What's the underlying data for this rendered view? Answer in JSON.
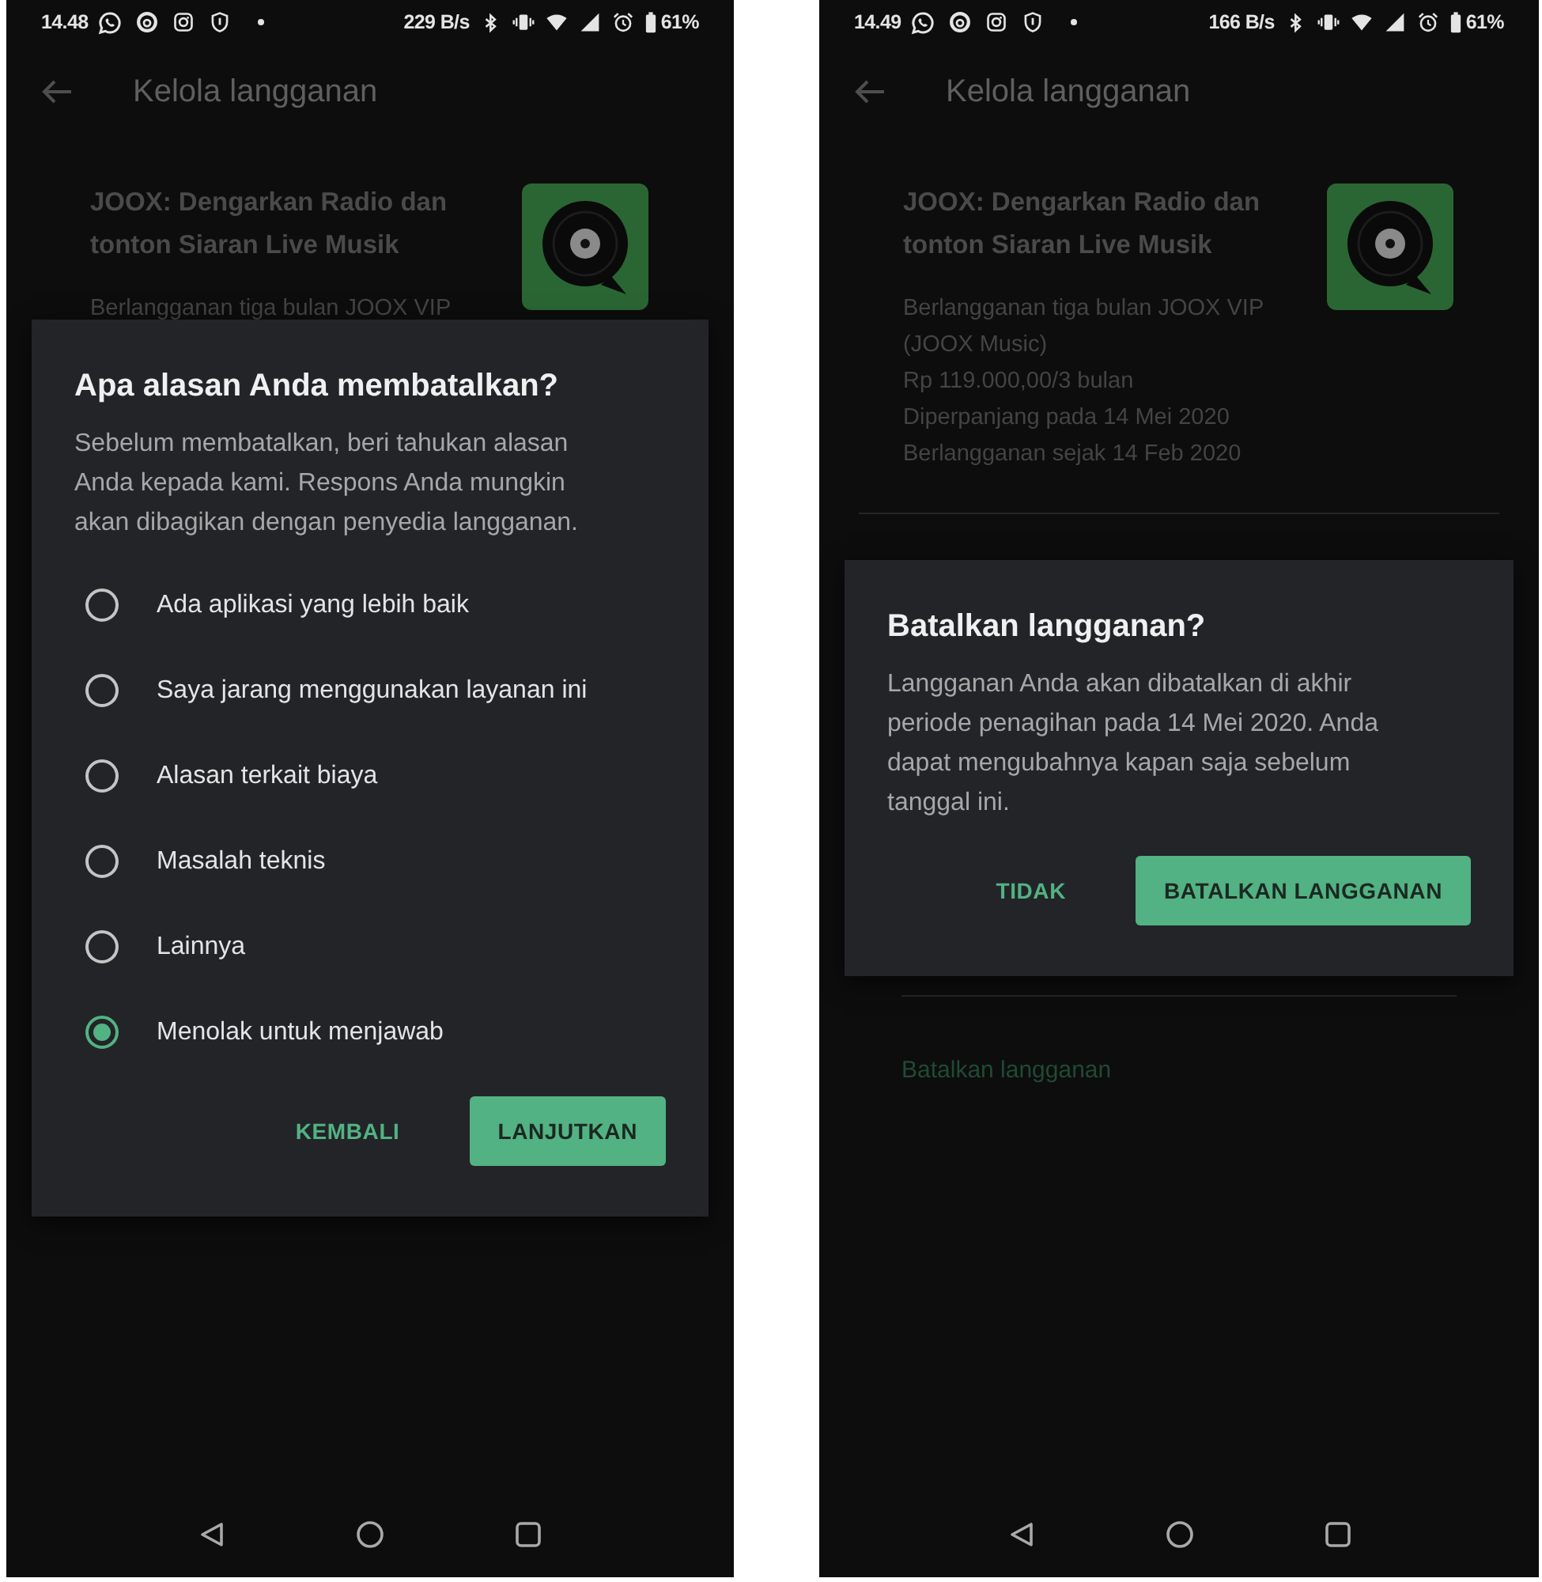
{
  "screens": [
    {
      "status_bar": {
        "time": "14.48",
        "net_speed": "229 B/s",
        "battery": "61%"
      },
      "app_bar": {
        "title": "Kelola langganan"
      },
      "subscription": {
        "app_name": "JOOX: Dengarkan Radio dan tonton Siaran Live Musik",
        "details": [
          "Berlangganan tiga bulan JOOX VIP"
        ]
      },
      "dialog": {
        "title": "Apa alasan Anda membatalkan?",
        "body": "Sebelum membatalkan, beri tahukan alasan Anda kepada kami. Respons Anda mungkin akan dibagikan dengan penyedia langganan.",
        "options": [
          {
            "label": "Ada aplikasi yang lebih baik",
            "selected": false
          },
          {
            "label": "Saya jarang menggunakan layanan ini",
            "selected": false
          },
          {
            "label": "Alasan terkait biaya",
            "selected": false
          },
          {
            "label": "Masalah teknis",
            "selected": false
          },
          {
            "label": "Lainnya",
            "selected": false
          },
          {
            "label": "Menolak untuk menjawab",
            "selected": true
          }
        ],
        "buttons": [
          {
            "label": "KEMBALI",
            "kind": "text"
          },
          {
            "label": "LANJUTKAN",
            "kind": "filled"
          }
        ]
      }
    },
    {
      "status_bar": {
        "time": "14.49",
        "net_speed": "166 B/s",
        "battery": "61%"
      },
      "app_bar": {
        "title": "Kelola langganan"
      },
      "subscription": {
        "app_name": "JOOX: Dengarkan Radio dan tonton Siaran Live Musik",
        "details": [
          "Berlangganan tiga bulan JOOX VIP",
          "(JOOX Music)",
          "Rp 119.000,00/3 bulan",
          "Diperpanjang pada 14 Mei 2020",
          "Berlangganan sejak 14 Feb 2020"
        ]
      },
      "cancel_link": "Batalkan langganan",
      "dialog": {
        "title": "Batalkan langganan?",
        "body": "Langganan Anda akan dibatalkan di akhir periode penagihan pada 14 Mei 2020. Anda dapat mengubahnya kapan saja sebelum tanggal ini.",
        "buttons": [
          {
            "label": "TIDAK",
            "kind": "text"
          },
          {
            "label": "BATALKAN LANGGANAN",
            "kind": "filled"
          }
        ]
      }
    }
  ]
}
